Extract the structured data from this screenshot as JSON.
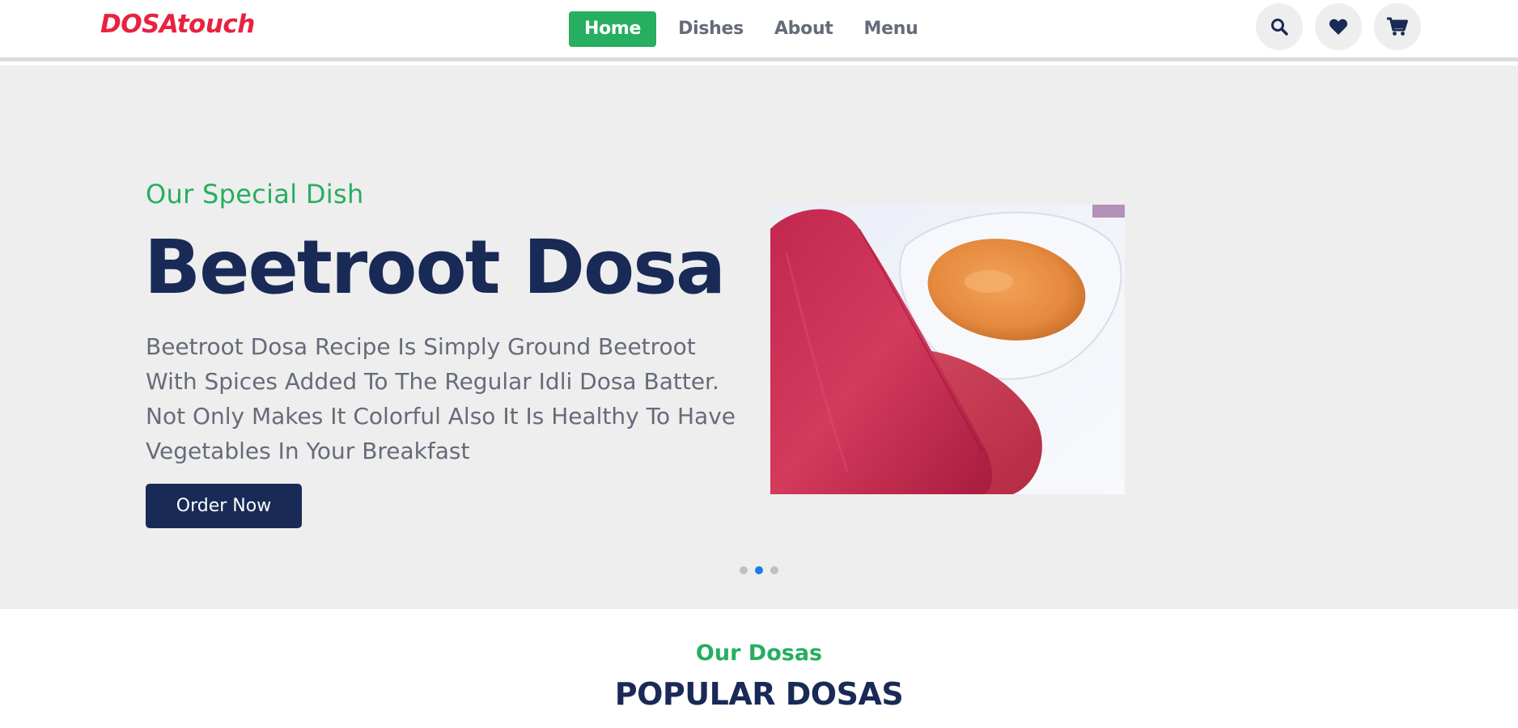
{
  "header": {
    "logo": "DOSAtouch",
    "nav": [
      {
        "label": "Home",
        "active": true
      },
      {
        "label": "Dishes",
        "active": false
      },
      {
        "label": "About",
        "active": false
      },
      {
        "label": "Menu",
        "active": false
      }
    ],
    "icons": [
      "search-icon",
      "heart-icon",
      "cart-icon"
    ]
  },
  "hero": {
    "subtitle": "Our Special Dish",
    "title": "Beetroot Dosa",
    "description": "Beetroot Dosa Recipe Is Simply Ground Beetroot With Spices Added To The Regular Idli Dosa Batter. Not Only Makes It Colorful Also It Is Healthy To Have Vegetables In Your Breakfast",
    "button_label": "Order Now",
    "slides_total": 3,
    "active_slide": 2
  },
  "section": {
    "subtitle": "Our Dosas",
    "title": "POPULAR DOSAS"
  },
  "colors": {
    "brand_red": "#e8223f",
    "accent_green": "#27ae60",
    "navy": "#192a56",
    "text_gray": "#666b7a",
    "hero_bg": "#eeeeee",
    "dot_active": "#1e7be6"
  }
}
